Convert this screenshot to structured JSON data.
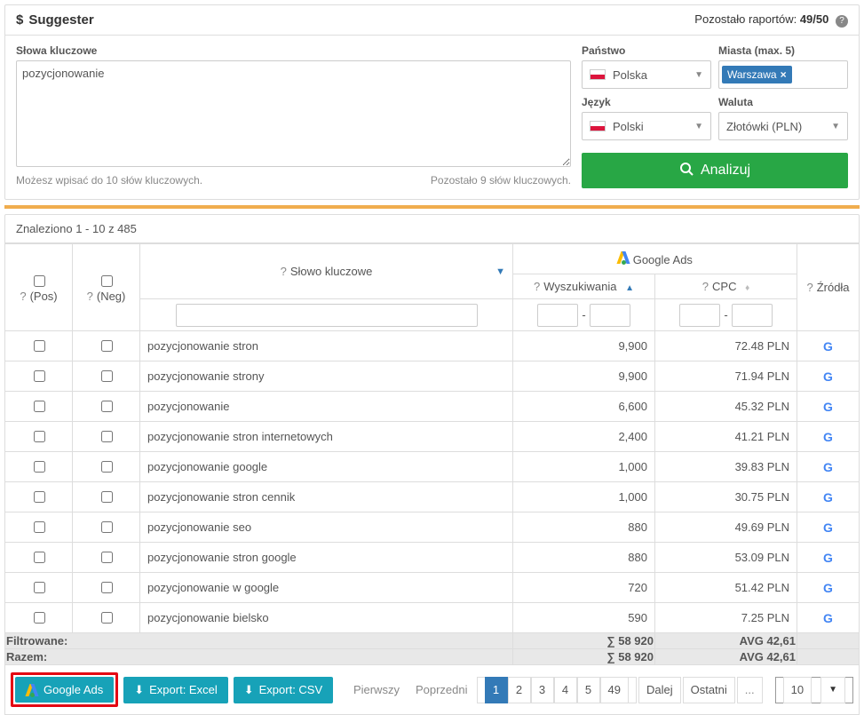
{
  "header": {
    "title": "Suggester",
    "reports_label": "Pozostało raportów:",
    "reports_value": "49/50"
  },
  "form": {
    "keywords_label": "Słowa kluczowe",
    "keywords_value": "pozycjonowanie",
    "keywords_hint_left": "Możesz wpisać do 10 słów kluczowych.",
    "keywords_hint_right": "Pozostało 9 słów kluczowych.",
    "country_label": "Państwo",
    "country_value": "Polska",
    "cities_label": "Miasta (max. 5)",
    "city_tag": "Warszawa",
    "language_label": "Język",
    "language_value": "Polski",
    "currency_label": "Waluta",
    "currency_value": "Złotówki (PLN)",
    "analyze_button": "Analizuj"
  },
  "results": {
    "summary": "Znaleziono 1 - 10 z 485",
    "columns": {
      "pos": "(Pos)",
      "neg": "(Neg)",
      "keyword": "Słowo kluczowe",
      "google_ads": "Google Ads",
      "searches": "Wyszukiwania",
      "cpc": "CPC",
      "sources": "Źródła"
    },
    "rows": [
      {
        "kw": "pozycjonowanie stron",
        "searches": "9,900",
        "cpc": "72.48 PLN"
      },
      {
        "kw": "pozycjonowanie strony",
        "searches": "9,900",
        "cpc": "71.94 PLN"
      },
      {
        "kw": "pozycjonowanie",
        "searches": "6,600",
        "cpc": "45.32 PLN"
      },
      {
        "kw": "pozycjonowanie stron internetowych",
        "searches": "2,400",
        "cpc": "41.21 PLN"
      },
      {
        "kw": "pozycjonowanie google",
        "searches": "1,000",
        "cpc": "39.83 PLN"
      },
      {
        "kw": "pozycjonowanie stron cennik",
        "searches": "1,000",
        "cpc": "30.75 PLN"
      },
      {
        "kw": "pozycjonowanie seo",
        "searches": "880",
        "cpc": "49.69 PLN"
      },
      {
        "kw": "pozycjonowanie stron google",
        "searches": "880",
        "cpc": "53.09 PLN"
      },
      {
        "kw": "pozycjonowanie w google",
        "searches": "720",
        "cpc": "51.42 PLN"
      },
      {
        "kw": "pozycjonowanie bielsko",
        "searches": "590",
        "cpc": "7.25 PLN"
      }
    ],
    "filtered_label": "Filtrowane:",
    "total_label": "Razem:",
    "sum_searches": "∑ 58 920",
    "avg_cpc": "AVG 42,61"
  },
  "footer": {
    "google_ads_btn": "Google Ads",
    "export_excel": "Export: Excel",
    "export_csv": "Export: CSV",
    "pager": {
      "first": "Pierwszy",
      "prev": "Poprzedni",
      "pages": [
        "1",
        "2",
        "3",
        "4",
        "5",
        "49"
      ],
      "active": "1",
      "next": "Dalej",
      "last": "Ostatni",
      "ellipsis": "..."
    },
    "page_size": "10"
  },
  "chart_data": {
    "type": "table",
    "title": "Suggester keyword results",
    "columns": [
      "Słowo kluczowe",
      "Wyszukiwania",
      "CPC (PLN)"
    ],
    "rows": [
      [
        "pozycjonowanie stron",
        9900,
        72.48
      ],
      [
        "pozycjonowanie strony",
        9900,
        71.94
      ],
      [
        "pozycjonowanie",
        6600,
        45.32
      ],
      [
        "pozycjonowanie stron internetowych",
        2400,
        41.21
      ],
      [
        "pozycjonowanie google",
        1000,
        39.83
      ],
      [
        "pozycjonowanie stron cennik",
        1000,
        30.75
      ],
      [
        "pozycjonowanie seo",
        880,
        49.69
      ],
      [
        "pozycjonowanie stron google",
        880,
        53.09
      ],
      [
        "pozycjonowanie w google",
        720,
        51.42
      ],
      [
        "pozycjonowanie bielsko",
        590,
        7.25
      ]
    ],
    "totals": {
      "sum_searches": 58920,
      "avg_cpc": 42.61
    }
  }
}
